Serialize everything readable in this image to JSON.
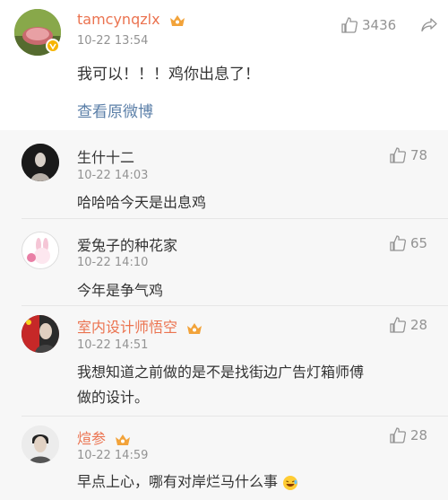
{
  "main_comment": {
    "username": "tamcynqzlx",
    "timestamp": "10-22 13:54",
    "like_count": "3436",
    "text": "我可以！！！鸡你出息了！",
    "view_original_link": "查看原微博"
  },
  "replies": [
    {
      "username": "生什十二",
      "timestamp": "10-22 14:03",
      "like_count": "78",
      "text": "哈哈哈今天是出息鸡"
    },
    {
      "username": "爱兔子的种花家",
      "timestamp": "10-22 14:10",
      "like_count": "65",
      "text": "今年是争气鸡"
    },
    {
      "username": "室内设计师悟空",
      "timestamp": "10-22 14:51",
      "like_count": "28",
      "text_line1": "我想知道之前做的是不是找街边广告灯箱师傅",
      "text_line2": "做的设计。"
    },
    {
      "username": "煊参",
      "timestamp": "10-22 14:59",
      "like_count": "28",
      "text": "早点上心，哪有对岸烂马什么事"
    }
  ],
  "colors": {
    "vip_name": "#eb7350",
    "link": "#5b7fa8",
    "meta": "#939393",
    "reply_bg": "#f7f7f7"
  }
}
